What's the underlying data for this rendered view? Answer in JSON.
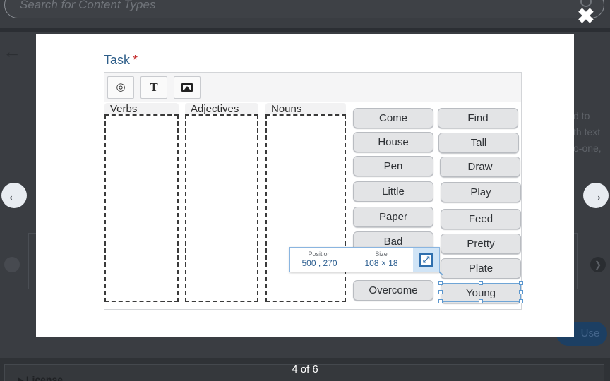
{
  "background": {
    "search_placeholder": "Search for Content Types",
    "side_text": [
      "d to",
      "th text",
      "o-one,"
    ],
    "use_button": "Use",
    "license_label": "License"
  },
  "counter": "4 of 6",
  "task": {
    "title": "Task",
    "required_marker": "*"
  },
  "toolbar": {
    "tools": [
      "target-icon",
      "text-icon",
      "image-icon"
    ],
    "text_tool_glyph": "T"
  },
  "drop_zones": [
    "Verbs",
    "Adjectives",
    "Nouns"
  ],
  "words_left": [
    "Come",
    "House",
    "Pen",
    "Little",
    "Paper",
    "Bad",
    "Overcome"
  ],
  "words_right": [
    "Find",
    "Tall",
    "Draw",
    "Play",
    "Feed",
    "Pretty",
    "Plate",
    "Young"
  ],
  "position_tooltip": {
    "position_label": "Position",
    "position_value": "500 , 270",
    "size_label": "Size",
    "size_value": "108 × 18"
  },
  "colors": {
    "title": "#2f5f8a",
    "required": "#c53030",
    "selection": "#6fa5d6",
    "overlay": "#3a3d42"
  }
}
